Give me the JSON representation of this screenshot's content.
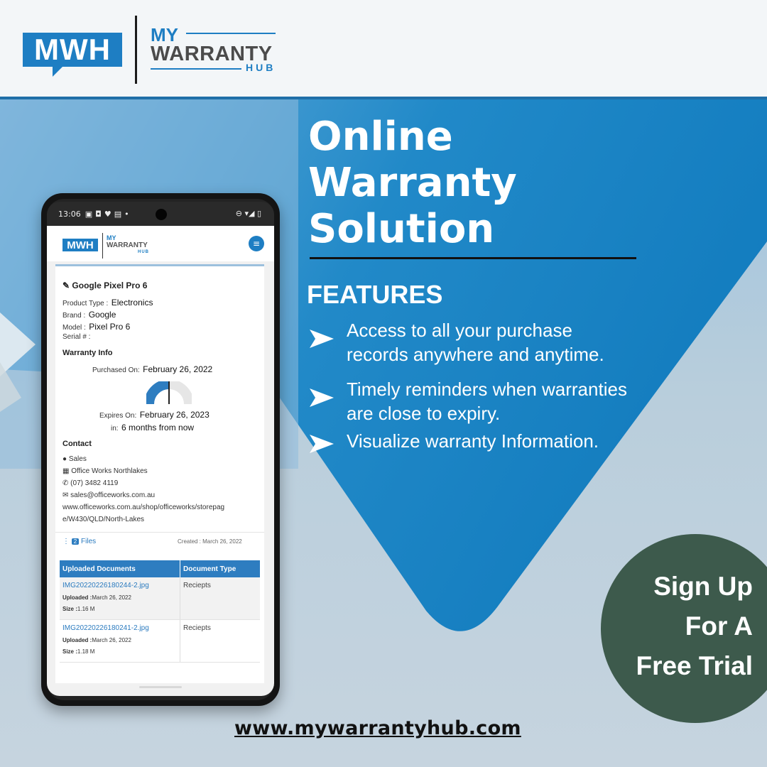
{
  "brand": {
    "logo_mark": "MWH",
    "logo_my": "MY",
    "logo_warranty": "WARRANTY",
    "logo_hub": "HUB",
    "accent_color": "#1e7ec3"
  },
  "headline": {
    "line1": "Online",
    "line2": "Warranty",
    "line3": "Solution"
  },
  "features": {
    "title": "FEATURES",
    "items": [
      {
        "line1": "Access to all your purchase",
        "line2": "records anywhere and anytime."
      },
      {
        "line1": "Timely reminders when warranties",
        "line2": "are close to expiry."
      },
      {
        "line1": "Visualize warranty Information.",
        "line2": ""
      }
    ]
  },
  "phone": {
    "status_time": "13:06",
    "app_logo": "MWH",
    "app_my": "MY",
    "app_warranty": "WARRANTY",
    "app_hub": "HUB",
    "product": {
      "name": "Google Pixel Pro 6",
      "type_label": "Product Type :",
      "type_value": "Electronics",
      "brand_label": "Brand :",
      "brand_value": "Google",
      "model_label": "Model :",
      "model_value": "Pixel Pro 6",
      "serial_label": "Serial # :"
    },
    "warranty": {
      "title": "Warranty Info",
      "purchased_label": "Purchased On:",
      "purchased_value": "February 26, 2022",
      "expires_label": "Expires On:",
      "expires_value": "February 26, 2023",
      "in_label": "in:",
      "in_value": "6 months from now",
      "gauge_fraction": 0.5
    },
    "contact": {
      "title": "Contact",
      "name": "Sales",
      "company": "Office Works Northlakes",
      "phone": "(07) 3482 4119",
      "email": "sales@officeworks.com.au",
      "url_line1": "www.officeworks.com.au/shop/officeworks/storepag",
      "url_line2": "e/W430/QLD/North-Lakes"
    },
    "files": {
      "count": "2",
      "label": "Files",
      "created": "Created : March 26, 2022"
    },
    "table": {
      "headers": [
        "Uploaded Documents",
        "Document Type"
      ],
      "rows": [
        {
          "file": "IMG20220226180244-2.jpg",
          "uploaded_label": "Uploaded :",
          "uploaded": "March 26, 2022",
          "size_label": "Size :",
          "size": "1.16 M",
          "type": "Reciepts"
        },
        {
          "file": "IMG20220226180241-2.jpg",
          "uploaded_label": "Uploaded :",
          "uploaded": "March 26, 2022",
          "size_label": "Size :",
          "size": "1.18 M",
          "type": "Reciepts"
        }
      ]
    }
  },
  "cta": {
    "line1": "Sign Up",
    "line2": "For A",
    "line3": "Free Trial",
    "color": "#3d5a4c"
  },
  "footer": {
    "url": "www.mywarrantyhub.com"
  }
}
